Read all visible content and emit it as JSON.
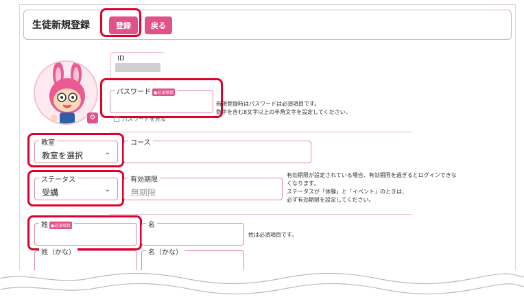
{
  "header": {
    "title": "生徒新規登録",
    "register_label": "登録",
    "back_label": "戻る"
  },
  "profile": {
    "id_label": "ID"
  },
  "password": {
    "label": "パスワード",
    "required_badge": "●必須項目",
    "note_line1": "新規登録時はパスワードは必須項目です。",
    "note_line2": "数字を含む8文字以上の半角文字を設定してください。",
    "show_label": "パスワードを見る"
  },
  "classroom": {
    "label": "教室",
    "value": "教室を選択"
  },
  "course": {
    "label": "コース"
  },
  "status": {
    "label": "ステータス",
    "value": "受講"
  },
  "expiry": {
    "label": "有効期限",
    "placeholder": "無期限",
    "note_line1": "有効期限が設定されている場合、有効期限を過ぎるとログインできな",
    "note_line2": "くなります。",
    "note_line3": "ステータスが「体験」と「イベント」のときは、",
    "note_line4": "必ず有効期限を設定してください。"
  },
  "name": {
    "last_label": "姓",
    "required_badge": "●必須項目",
    "first_label": "名",
    "note": "姓は必須項目です。",
    "last_kana_label": "姓（かな）",
    "first_kana_label": "名（かな）"
  },
  "colors": {
    "accent": "#e2528a",
    "highlight": "#e0002a",
    "field_border": "#dd88a9"
  }
}
